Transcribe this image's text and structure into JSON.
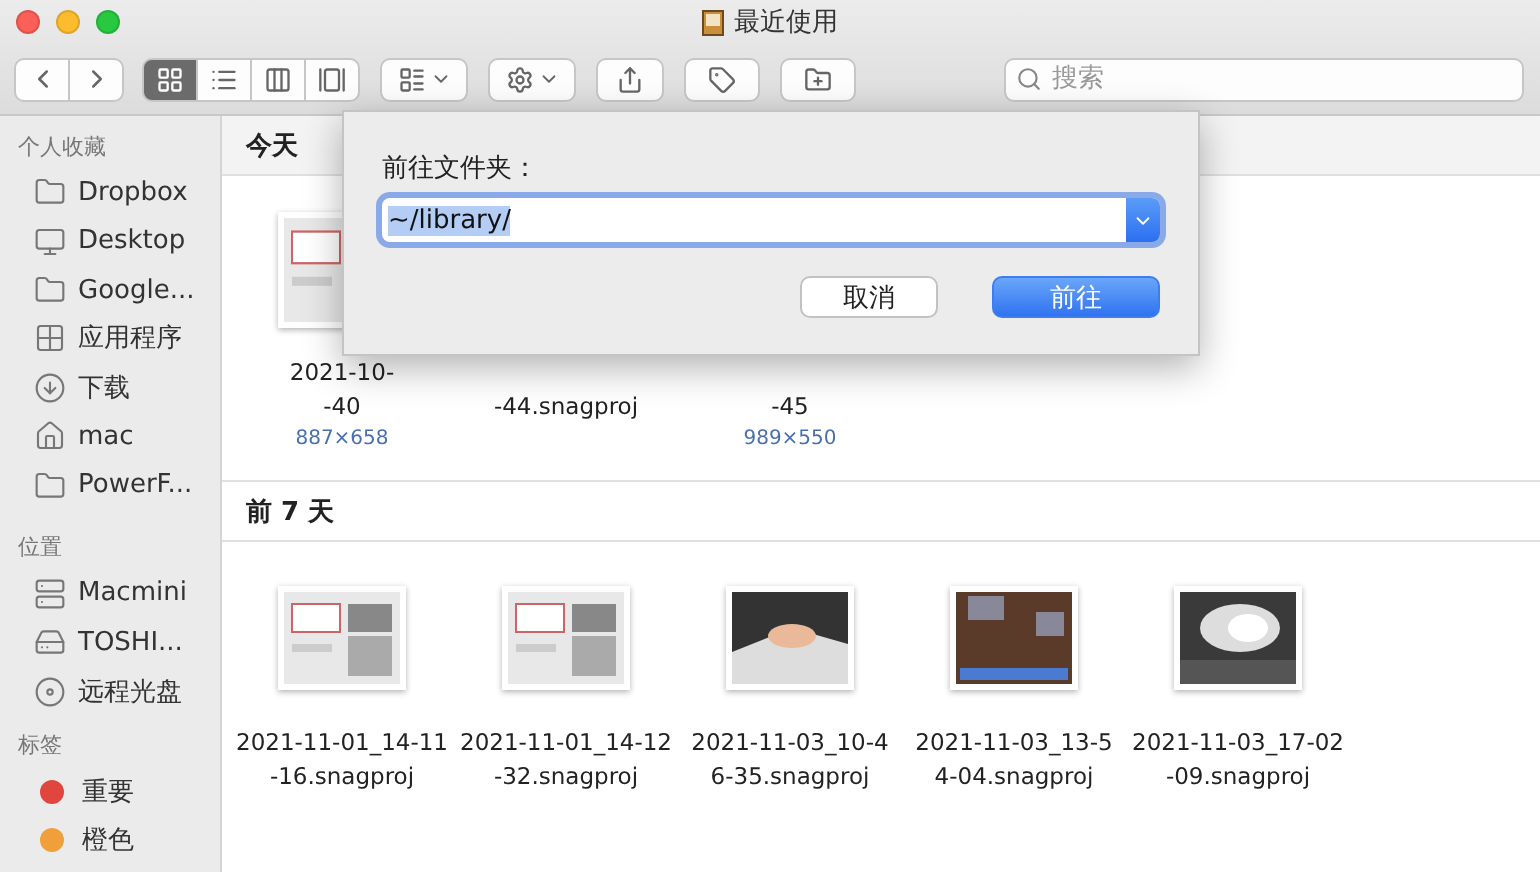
{
  "window": {
    "title": "最近使用"
  },
  "toolbar": {
    "view_modes": [
      {
        "selected": true
      },
      {
        "selected": false
      },
      {
        "selected": false
      },
      {
        "selected": false
      }
    ],
    "search": {
      "placeholder": "搜索"
    }
  },
  "sidebar": {
    "sections": [
      {
        "heading": "个人收藏",
        "items": [
          {
            "label": "Dropbox",
            "kind": "folder"
          },
          {
            "label": "Desktop",
            "kind": "desktop"
          },
          {
            "label": "Google...",
            "kind": "folder"
          },
          {
            "label": "应用程序",
            "kind": "apps"
          },
          {
            "label": "下载",
            "kind": "download"
          },
          {
            "label": "mac",
            "kind": "home"
          },
          {
            "label": "PowerF...",
            "kind": "folder"
          }
        ]
      },
      {
        "heading": "位置",
        "items": [
          {
            "label": "Macmini",
            "kind": "computer"
          },
          {
            "label": "TOSHI...",
            "kind": "drive"
          },
          {
            "label": "远程光盘",
            "kind": "disc"
          }
        ]
      },
      {
        "heading": "标签",
        "items": [
          {
            "label": "重要",
            "kind": "tag",
            "color": "#e0463e"
          },
          {
            "label": "橙色",
            "kind": "tag",
            "color": "#f0a03a"
          }
        ]
      }
    ]
  },
  "groups": [
    {
      "heading": "今天",
      "files": [
        {
          "name_lines": [
            "2021-10-",
            "-40"
          ],
          "dimensions": "887×658"
        },
        {
          "name_lines": [
            "-44.snagproj"
          ]
        },
        {
          "name_lines": [
            "-45"
          ],
          "dimensions": "989×550"
        }
      ]
    },
    {
      "heading": "前 7 天",
      "files": [
        {
          "name_lines": [
            "2021-11-01_14-11",
            "-16.snagproj"
          ]
        },
        {
          "name_lines": [
            "2021-11-01_14-12",
            "-32.snagproj"
          ]
        },
        {
          "name_lines": [
            "2021-11-03_10-4",
            "6-35.snagproj"
          ]
        },
        {
          "name_lines": [
            "2021-11-03_13-5",
            "4-04.snagproj"
          ]
        },
        {
          "name_lines": [
            "2021-11-03_17-02",
            "-09.snagproj"
          ]
        }
      ]
    }
  ],
  "dialog": {
    "label": "前往文件夹：",
    "value": "~/library/",
    "value_selected": true,
    "buttons": [
      {
        "label": "取消",
        "kind": "cancel"
      },
      {
        "label": "前往",
        "kind": "default"
      }
    ]
  }
}
